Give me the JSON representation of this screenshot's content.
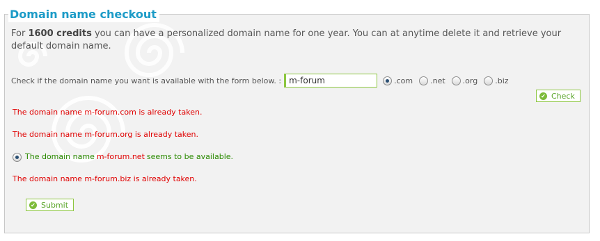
{
  "title": "Domain name checkout",
  "intro": {
    "prefix": "For",
    "credits": "1600 credits",
    "suffix": "you can have a personalized domain name for one year. You can at anytime delete it and retrieve your default domain name."
  },
  "check_form": {
    "label": "Check if the domain name you want is available with the form below. :",
    "domain_value": "m-forum",
    "extensions": [
      {
        "label": ".com",
        "selected": true
      },
      {
        "label": ".net",
        "selected": false
      },
      {
        "label": ".org",
        "selected": false
      },
      {
        "label": ".biz",
        "selected": false
      }
    ],
    "check_label": "Check"
  },
  "results": {
    "com": "The domain name m-forum.com is already taken.",
    "org": "The domain name m-forum.org is already taken.",
    "net": {
      "prefix": "The domain name",
      "domain": "m-forum.net",
      "suffix": "seems to be available.",
      "selected": true
    },
    "biz": "The domain name m-forum.biz is already taken."
  },
  "submit_label": "Submit",
  "colors": {
    "accent": "#1c9bc7",
    "taken": "#e00000",
    "available": "#2a8a00",
    "button_border": "#8cc63f"
  }
}
